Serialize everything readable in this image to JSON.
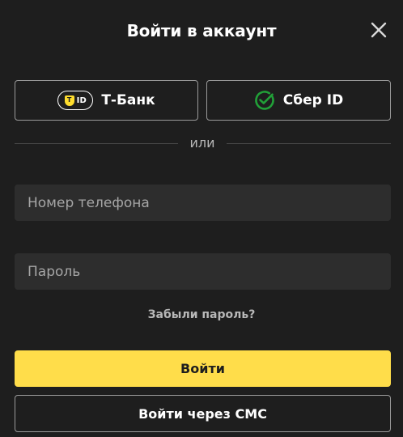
{
  "modal": {
    "title": "Войти в аккаунт",
    "close_icon": "close-icon"
  },
  "providers": [
    {
      "label": "Т-Банк",
      "icon": "tbank-id-icon",
      "badge_text": "ID",
      "badge_letter": "T",
      "accent": "#ffdd2d"
    },
    {
      "label": "Сбер ID",
      "icon": "sber-check-icon",
      "accent": "#21a038"
    }
  ],
  "divider": {
    "text": "или"
  },
  "form": {
    "phone": {
      "placeholder": "Номер телефона",
      "value": ""
    },
    "password": {
      "placeholder": "Пароль",
      "value": ""
    },
    "forgot_link": "Забыли пароль?",
    "submit_label": "Войти",
    "sms_label": "Войти через СМС"
  },
  "colors": {
    "background": "#1e1e1e",
    "field_background": "#2d2d2d",
    "primary": "#ffdd4a",
    "border": "#9a9a9a",
    "muted_text": "#b8b8b8"
  }
}
